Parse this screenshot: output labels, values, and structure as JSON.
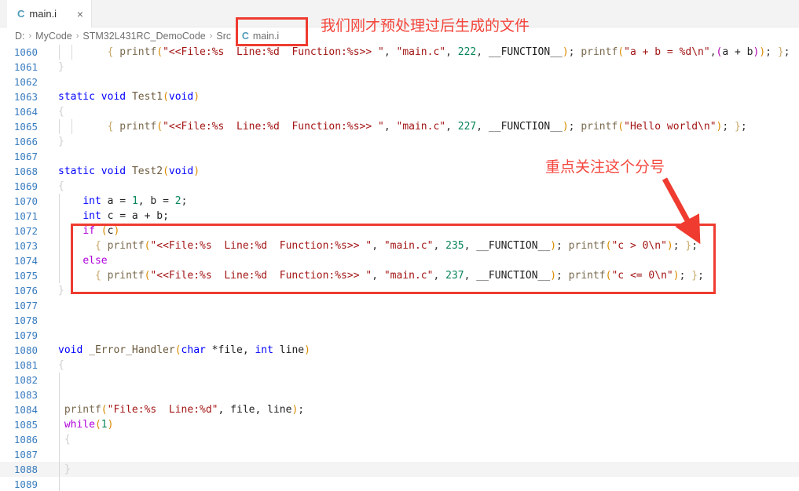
{
  "tab": {
    "icon": "c-file-icon",
    "label": "main.i",
    "close": "×"
  },
  "breadcrumb": {
    "items": [
      "D:",
      "MyCode",
      "STM32L431RC_DemoCode",
      "Src"
    ],
    "separator": "›",
    "file_icon": "c-file-icon",
    "file": "main.i"
  },
  "annotations": {
    "file_note": "我们刚才预处理过后生成的文件",
    "semicolon_note": "重点关注这个分号",
    "color": "#f4463c"
  },
  "editor": {
    "first_line": 1060,
    "lines": [
      {
        "n": 1060,
        "tokens": [
          {
            "t": "{ ",
            "c": "t-brace"
          },
          {
            "t": "printf",
            "c": "t-printf"
          },
          {
            "t": "(",
            "c": "t-paren"
          },
          {
            "t": "\"<<File:%s  Line:%d  Function:%s>> \"",
            "c": "t-str"
          },
          {
            "t": ", ",
            "c": "t-punc"
          },
          {
            "t": "\"main.c\"",
            "c": "t-str"
          },
          {
            "t": ", ",
            "c": "t-punc"
          },
          {
            "t": "222",
            "c": "t-num"
          },
          {
            "t": ", ",
            "c": "t-punc"
          },
          {
            "t": "__FUNCTION__",
            "c": "t-plain"
          },
          {
            "t": ")",
            "c": "t-paren"
          },
          {
            "t": "; ",
            "c": "t-punc"
          },
          {
            "t": "printf",
            "c": "t-printf"
          },
          {
            "t": "(",
            "c": "t-paren"
          },
          {
            "t": "\"a + b = %d\\n\"",
            "c": "t-str"
          },
          {
            "t": ",",
            "c": "t-punc"
          },
          {
            "t": "(",
            "c": "t-paren2"
          },
          {
            "t": "a + b",
            "c": "t-plain"
          },
          {
            "t": ")",
            "c": "t-paren2"
          },
          {
            "t": ")",
            "c": "t-paren"
          },
          {
            "t": "; ",
            "c": "t-punc"
          },
          {
            "t": "}",
            "c": "t-brace"
          },
          {
            "t": ";",
            "c": "t-punc"
          }
        ],
        "indent": 8,
        "guides": [
          1,
          2
        ]
      },
      {
        "n": 1061,
        "tokens": [
          {
            "t": "}",
            "c": "t-brace-d"
          }
        ],
        "indent": 0,
        "guides": []
      },
      {
        "n": 1062,
        "tokens": [],
        "indent": 0,
        "guides": []
      },
      {
        "n": 1063,
        "tokens": [
          {
            "t": "static",
            "c": "t-kw"
          },
          {
            "t": " ",
            "c": "t-punc"
          },
          {
            "t": "void",
            "c": "t-kw"
          },
          {
            "t": " ",
            "c": "t-punc"
          },
          {
            "t": "Test1",
            "c": "t-fn"
          },
          {
            "t": "(",
            "c": "t-paren"
          },
          {
            "t": "void",
            "c": "t-kw"
          },
          {
            "t": ")",
            "c": "t-paren"
          }
        ],
        "indent": 0,
        "guides": []
      },
      {
        "n": 1064,
        "tokens": [
          {
            "t": "{",
            "c": "t-brace-d"
          }
        ],
        "indent": 0,
        "guides": []
      },
      {
        "n": 1065,
        "tokens": [
          {
            "t": "{ ",
            "c": "t-brace"
          },
          {
            "t": "printf",
            "c": "t-printf"
          },
          {
            "t": "(",
            "c": "t-paren"
          },
          {
            "t": "\"<<File:%s  Line:%d  Function:%s>> \"",
            "c": "t-str"
          },
          {
            "t": ", ",
            "c": "t-punc"
          },
          {
            "t": "\"main.c\"",
            "c": "t-str"
          },
          {
            "t": ", ",
            "c": "t-punc"
          },
          {
            "t": "227",
            "c": "t-num"
          },
          {
            "t": ", ",
            "c": "t-punc"
          },
          {
            "t": "__FUNCTION__",
            "c": "t-plain"
          },
          {
            "t": ")",
            "c": "t-paren"
          },
          {
            "t": "; ",
            "c": "t-punc"
          },
          {
            "t": "printf",
            "c": "t-printf"
          },
          {
            "t": "(",
            "c": "t-paren"
          },
          {
            "t": "\"Hello world\\n\"",
            "c": "t-str"
          },
          {
            "t": ")",
            "c": "t-paren"
          },
          {
            "t": "; ",
            "c": "t-punc"
          },
          {
            "t": "}",
            "c": "t-brace"
          },
          {
            "t": ";",
            "c": "t-punc"
          }
        ],
        "indent": 8,
        "guides": [
          1,
          2
        ]
      },
      {
        "n": 1066,
        "tokens": [
          {
            "t": "}",
            "c": "t-brace-d"
          }
        ],
        "indent": 0,
        "guides": []
      },
      {
        "n": 1067,
        "tokens": [],
        "indent": 0,
        "guides": []
      },
      {
        "n": 1068,
        "tokens": [
          {
            "t": "static",
            "c": "t-kw"
          },
          {
            "t": " ",
            "c": "t-punc"
          },
          {
            "t": "void",
            "c": "t-kw"
          },
          {
            "t": " ",
            "c": "t-punc"
          },
          {
            "t": "Test2",
            "c": "t-fn"
          },
          {
            "t": "(",
            "c": "t-paren"
          },
          {
            "t": "void",
            "c": "t-kw"
          },
          {
            "t": ")",
            "c": "t-paren"
          }
        ],
        "indent": 0,
        "guides": []
      },
      {
        "n": 1069,
        "tokens": [
          {
            "t": "{",
            "c": "t-brace-d"
          }
        ],
        "indent": 0,
        "guides": []
      },
      {
        "n": 1070,
        "tokens": [
          {
            "t": "int",
            "c": "t-kw"
          },
          {
            "t": " a = ",
            "c": "t-plain"
          },
          {
            "t": "1",
            "c": "t-num"
          },
          {
            "t": ", b = ",
            "c": "t-plain"
          },
          {
            "t": "2",
            "c": "t-num"
          },
          {
            "t": ";",
            "c": "t-punc"
          }
        ],
        "indent": 4,
        "guides": [
          1
        ]
      },
      {
        "n": 1071,
        "tokens": [
          {
            "t": "int",
            "c": "t-kw"
          },
          {
            "t": " c = a + b;",
            "c": "t-plain"
          }
        ],
        "indent": 4,
        "guides": [
          1
        ]
      },
      {
        "n": 1072,
        "tokens": [
          {
            "t": "if",
            "c": "t-ctl"
          },
          {
            "t": " ",
            "c": "t-punc"
          },
          {
            "t": "(",
            "c": "t-paren"
          },
          {
            "t": "c",
            "c": "t-plain"
          },
          {
            "t": ")",
            "c": "t-paren"
          }
        ],
        "indent": 4,
        "guides": [
          1
        ]
      },
      {
        "n": 1073,
        "tokens": [
          {
            "t": "{ ",
            "c": "t-brace"
          },
          {
            "t": "printf",
            "c": "t-printf"
          },
          {
            "t": "(",
            "c": "t-paren"
          },
          {
            "t": "\"<<File:%s  Line:%d  Function:%s>> \"",
            "c": "t-str"
          },
          {
            "t": ", ",
            "c": "t-punc"
          },
          {
            "t": "\"main.c\"",
            "c": "t-str"
          },
          {
            "t": ", ",
            "c": "t-punc"
          },
          {
            "t": "235",
            "c": "t-num"
          },
          {
            "t": ", ",
            "c": "t-punc"
          },
          {
            "t": "__FUNCTION__",
            "c": "t-plain"
          },
          {
            "t": ")",
            "c": "t-paren"
          },
          {
            "t": "; ",
            "c": "t-punc"
          },
          {
            "t": "printf",
            "c": "t-printf"
          },
          {
            "t": "(",
            "c": "t-paren"
          },
          {
            "t": "\"c > 0\\n\"",
            "c": "t-str"
          },
          {
            "t": ")",
            "c": "t-paren"
          },
          {
            "t": "; ",
            "c": "t-punc"
          },
          {
            "t": "}",
            "c": "t-brace"
          },
          {
            "t": ";",
            "c": "t-punc"
          }
        ],
        "indent": 6,
        "guides": [
          1,
          2
        ]
      },
      {
        "n": 1074,
        "tokens": [
          {
            "t": "else",
            "c": "t-ctl"
          }
        ],
        "indent": 4,
        "guides": [
          1
        ]
      },
      {
        "n": 1075,
        "tokens": [
          {
            "t": "{ ",
            "c": "t-brace"
          },
          {
            "t": "printf",
            "c": "t-printf"
          },
          {
            "t": "(",
            "c": "t-paren"
          },
          {
            "t": "\"<<File:%s  Line:%d  Function:%s>> \"",
            "c": "t-str"
          },
          {
            "t": ", ",
            "c": "t-punc"
          },
          {
            "t": "\"main.c\"",
            "c": "t-str"
          },
          {
            "t": ", ",
            "c": "t-punc"
          },
          {
            "t": "237",
            "c": "t-num"
          },
          {
            "t": ", ",
            "c": "t-punc"
          },
          {
            "t": "__FUNCTION__",
            "c": "t-plain"
          },
          {
            "t": ")",
            "c": "t-paren"
          },
          {
            "t": "; ",
            "c": "t-punc"
          },
          {
            "t": "printf",
            "c": "t-printf"
          },
          {
            "t": "(",
            "c": "t-paren"
          },
          {
            "t": "\"c <= 0\\n\"",
            "c": "t-str"
          },
          {
            "t": ")",
            "c": "t-paren"
          },
          {
            "t": "; ",
            "c": "t-punc"
          },
          {
            "t": "}",
            "c": "t-brace"
          },
          {
            "t": ";",
            "c": "t-punc"
          }
        ],
        "indent": 6,
        "guides": [
          1,
          2
        ]
      },
      {
        "n": 1076,
        "tokens": [
          {
            "t": "}",
            "c": "t-brace-d"
          }
        ],
        "indent": 0,
        "guides": []
      },
      {
        "n": 1077,
        "tokens": [],
        "indent": 0,
        "guides": []
      },
      {
        "n": 1078,
        "tokens": [],
        "indent": 0,
        "guides": []
      },
      {
        "n": 1079,
        "tokens": [],
        "indent": 0,
        "guides": []
      },
      {
        "n": 1080,
        "tokens": [
          {
            "t": "void",
            "c": "t-kw"
          },
          {
            "t": " ",
            "c": "t-punc"
          },
          {
            "t": "_Error_Handler",
            "c": "t-fn"
          },
          {
            "t": "(",
            "c": "t-paren"
          },
          {
            "t": "char",
            "c": "t-kw"
          },
          {
            "t": " *file, ",
            "c": "t-plain"
          },
          {
            "t": "int",
            "c": "t-kw"
          },
          {
            "t": " line",
            "c": "t-plain"
          },
          {
            "t": ")",
            "c": "t-paren"
          }
        ],
        "indent": 0,
        "guides": []
      },
      {
        "n": 1081,
        "tokens": [
          {
            "t": "{",
            "c": "t-brace-d"
          }
        ],
        "indent": 0,
        "guides": []
      },
      {
        "n": 1082,
        "tokens": [],
        "indent": 0,
        "guides": [
          1
        ]
      },
      {
        "n": 1083,
        "tokens": [],
        "indent": 0,
        "guides": [
          1
        ]
      },
      {
        "n": 1084,
        "tokens": [
          {
            "t": "printf",
            "c": "t-printf"
          },
          {
            "t": "(",
            "c": "t-paren"
          },
          {
            "t": "\"File:%s  Line:%d\"",
            "c": "t-str"
          },
          {
            "t": ", file, line",
            "c": "t-plain"
          },
          {
            "t": ")",
            "c": "t-paren"
          },
          {
            "t": ";",
            "c": "t-punc"
          }
        ],
        "indent": 1,
        "guides": [
          1
        ]
      },
      {
        "n": 1085,
        "tokens": [
          {
            "t": "while",
            "c": "t-ctl"
          },
          {
            "t": "(",
            "c": "t-paren"
          },
          {
            "t": "1",
            "c": "t-num"
          },
          {
            "t": ")",
            "c": "t-paren"
          }
        ],
        "indent": 1,
        "guides": [
          1
        ]
      },
      {
        "n": 1086,
        "tokens": [
          {
            "t": "{",
            "c": "t-brace-d"
          }
        ],
        "indent": 1,
        "guides": [
          1
        ]
      },
      {
        "n": 1087,
        "tokens": [],
        "indent": 0,
        "guides": [
          1
        ]
      },
      {
        "n": 1088,
        "tokens": [
          {
            "t": "}",
            "c": "t-brace-d"
          }
        ],
        "indent": 1,
        "guides": [
          1
        ],
        "highlight": true
      },
      {
        "n": 1089,
        "tokens": [],
        "indent": 0,
        "guides": [
          1
        ]
      }
    ]
  }
}
